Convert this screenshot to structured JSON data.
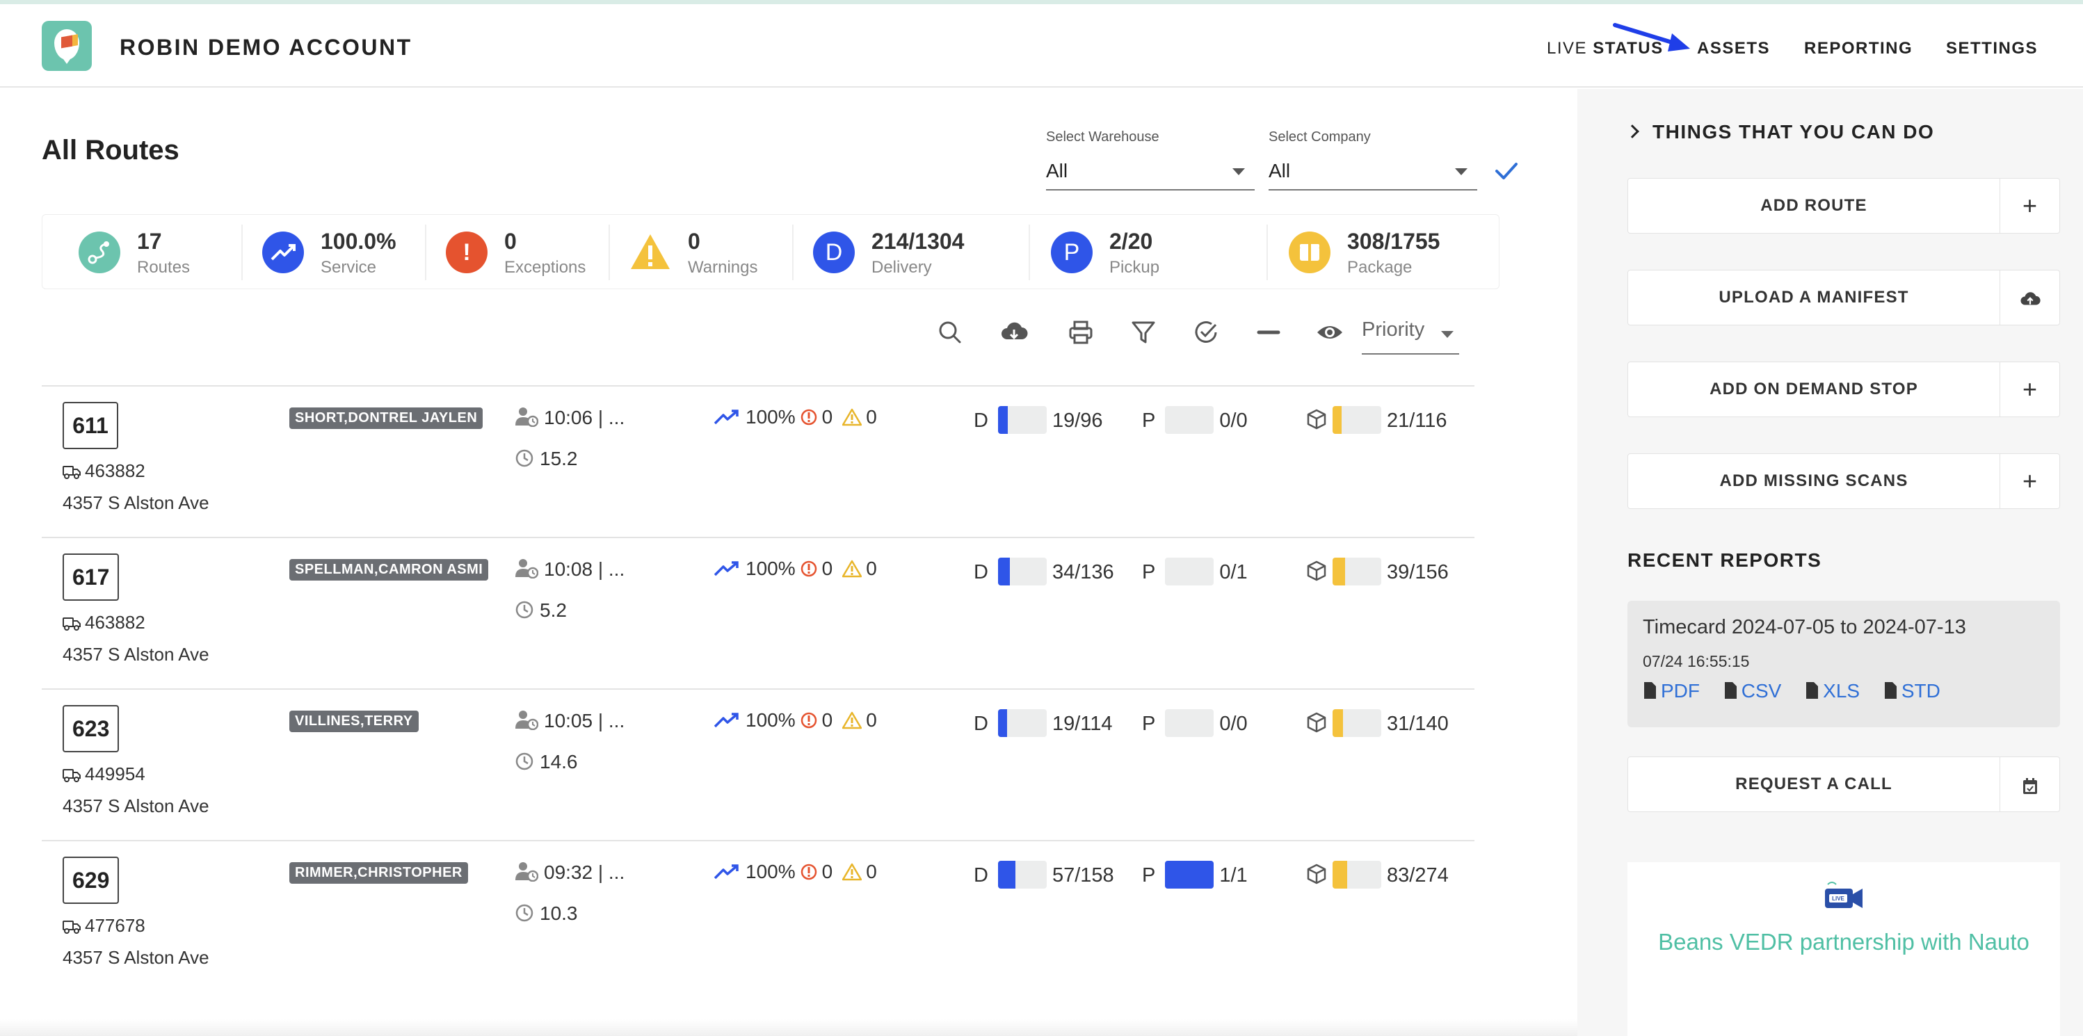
{
  "header": {
    "account": "ROBIN DEMO ACCOUNT",
    "nav": [
      {
        "thin": "LIVE ",
        "bold": "STATUS"
      },
      {
        "thin": "",
        "bold": "ASSETS"
      },
      {
        "thin": "",
        "bold": "REPORTING"
      },
      {
        "thin": "",
        "bold": "SETTINGS"
      }
    ]
  },
  "page_title": "All Routes",
  "filters": {
    "warehouse_label": "Select Warehouse",
    "warehouse_value": "All",
    "company_label": "Select Company",
    "company_value": "All"
  },
  "stats": [
    {
      "value": "17",
      "label": "Routes",
      "icon": "route-icon",
      "color": "#6cc4ae",
      "glyph": ""
    },
    {
      "value": "100.0%",
      "label": "Service",
      "icon": "trending-up-icon",
      "color": "#2f55e8",
      "glyph": ""
    },
    {
      "value": "0",
      "label": "Exceptions",
      "icon": "exclamation-icon",
      "color": "#e5532f",
      "glyph": "!"
    },
    {
      "value": "0",
      "label": "Warnings",
      "icon": "warning-icon",
      "color": "#f4c23c",
      "glyph": "!"
    },
    {
      "value": "214/1304",
      "label": "Delivery",
      "icon": "delivery-d-icon",
      "color": "#2f55e8",
      "glyph": "D"
    },
    {
      "value": "2/20",
      "label": "Pickup",
      "icon": "pickup-p-icon",
      "color": "#2f55e8",
      "glyph": "P"
    },
    {
      "value": "308/1755",
      "label": "Package",
      "icon": "package-icon",
      "color": "#f4c23c",
      "glyph": ""
    }
  ],
  "toolbar": {
    "priority_label": "Priority"
  },
  "routes": [
    {
      "number": "611",
      "vehicle": "463882",
      "address": "4357 S Alston Ave",
      "driver": "SHORT,DONTREL JAYLEN",
      "start": "10:06 | ...",
      "duration": "15.2",
      "service": "100%",
      "exceptions": "0",
      "warnings": "0",
      "delivery": "19/96",
      "delivery_frac": 0.198,
      "pickup": "0/0",
      "pickup_frac": 0,
      "package": "21/116",
      "package_frac": 0.181
    },
    {
      "number": "617",
      "vehicle": "463882",
      "address": "4357 S Alston Ave",
      "driver": "SPELLMAN,CAMRON ASMI",
      "start": "10:08 | ...",
      "duration": "5.2",
      "service": "100%",
      "exceptions": "0",
      "warnings": "0",
      "delivery": "34/136",
      "delivery_frac": 0.25,
      "pickup": "0/1",
      "pickup_frac": 0,
      "package": "39/156",
      "package_frac": 0.25
    },
    {
      "number": "623",
      "vehicle": "449954",
      "address": "4357 S Alston Ave",
      "driver": "VILLINES,TERRY",
      "start": "10:05 | ...",
      "duration": "14.6",
      "service": "100%",
      "exceptions": "0",
      "warnings": "0",
      "delivery": "19/114",
      "delivery_frac": 0.167,
      "pickup": "0/0",
      "pickup_frac": 0,
      "package": "31/140",
      "package_frac": 0.221
    },
    {
      "number": "629",
      "vehicle": "477678",
      "address": "4357 S Alston Ave",
      "driver": "RIMMER,CHRISTOPHER",
      "start": "09:32 | ...",
      "duration": "10.3",
      "service": "100%",
      "exceptions": "0",
      "warnings": "0",
      "delivery": "57/158",
      "delivery_frac": 0.361,
      "pickup": "1/1",
      "pickup_frac": 1.0,
      "package": "83/274",
      "package_frac": 0.303
    }
  ],
  "sidebar": {
    "things_title": "THINGS THAT YOU CAN DO",
    "actions": [
      {
        "label": "ADD ROUTE",
        "icon": "plus-icon",
        "glyph": "+"
      },
      {
        "label": "UPLOAD A MANIFEST",
        "icon": "cloud-upload-icon",
        "glyph": ""
      },
      {
        "label": "ADD ON DEMAND STOP",
        "icon": "plus-icon",
        "glyph": "+"
      },
      {
        "label": "ADD MISSING SCANS",
        "icon": "plus-icon",
        "glyph": "+"
      }
    ],
    "recent_title": "RECENT REPORTS",
    "report": {
      "title": "Timecard 2024-07-05 to 2024-07-13",
      "date": "07/24 16:55:15",
      "links": [
        "PDF",
        "CSV",
        "XLS",
        "STD"
      ]
    },
    "call_label": "REQUEST A CALL",
    "promo_text": "Beans VEDR partnership with Nauto"
  },
  "colors": {
    "brand": "#6cc4ae",
    "blue": "#2f55e8",
    "red": "#e5532f",
    "yellow": "#f4c23c",
    "link": "#2f6fd6"
  }
}
